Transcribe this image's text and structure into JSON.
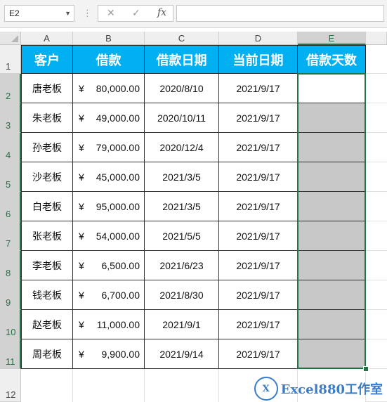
{
  "formula_bar": {
    "name_box": "E2",
    "cancel_icon": "✕",
    "enter_icon": "✓",
    "fx_label": "fx",
    "formula": ""
  },
  "columns": [
    "A",
    "B",
    "C",
    "D",
    "E"
  ],
  "rows": [
    "1",
    "2",
    "3",
    "4",
    "5",
    "6",
    "7",
    "8",
    "9",
    "10",
    "11",
    "12"
  ],
  "headers": [
    "客户",
    "借款",
    "借款日期",
    "当前日期",
    "借款天数"
  ],
  "table": [
    {
      "customer": "唐老板",
      "currency": "¥",
      "amount": "80,000.00",
      "loan_date": "2020/8/10",
      "current_date": "2021/9/17",
      "days": ""
    },
    {
      "customer": "朱老板",
      "currency": "¥",
      "amount": "49,000.00",
      "loan_date": "2020/10/11",
      "current_date": "2021/9/17",
      "days": ""
    },
    {
      "customer": "孙老板",
      "currency": "¥",
      "amount": "79,000.00",
      "loan_date": "2020/12/4",
      "current_date": "2021/9/17",
      "days": ""
    },
    {
      "customer": "沙老板",
      "currency": "¥",
      "amount": "45,000.00",
      "loan_date": "2021/3/5",
      "current_date": "2021/9/17",
      "days": ""
    },
    {
      "customer": "白老板",
      "currency": "¥",
      "amount": "95,000.00",
      "loan_date": "2021/3/5",
      "current_date": "2021/9/17",
      "days": ""
    },
    {
      "customer": "张老板",
      "currency": "¥",
      "amount": "54,000.00",
      "loan_date": "2021/5/5",
      "current_date": "2021/9/17",
      "days": ""
    },
    {
      "customer": "李老板",
      "currency": "¥",
      "amount": "6,500.00",
      "loan_date": "2021/6/23",
      "current_date": "2021/9/17",
      "days": ""
    },
    {
      "customer": "钱老板",
      "currency": "¥",
      "amount": "6,700.00",
      "loan_date": "2021/8/30",
      "current_date": "2021/9/17",
      "days": ""
    },
    {
      "customer": "赵老板",
      "currency": "¥",
      "amount": "11,000.00",
      "loan_date": "2021/9/1",
      "current_date": "2021/9/17",
      "days": ""
    },
    {
      "customer": "周老板",
      "currency": "¥",
      "amount": "9,900.00",
      "loan_date": "2021/9/14",
      "current_date": "2021/9/17",
      "days": ""
    }
  ],
  "watermark": {
    "logo": "X",
    "text": "Excel880工作室"
  },
  "colors": {
    "header_fill": "#00b0f0",
    "selection": "#217346",
    "gray_fill": "#c8c8c8"
  }
}
